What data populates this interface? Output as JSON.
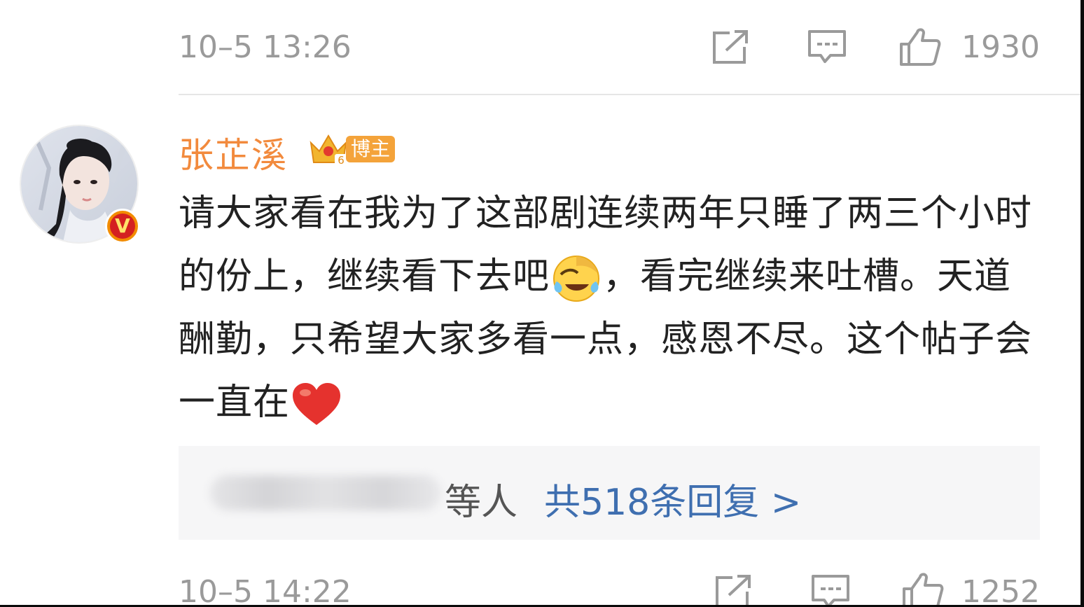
{
  "previous_comment": {
    "timestamp": "10–5 13:26",
    "like_count": "1930"
  },
  "comment": {
    "author": "张芷溪",
    "badge_label": "博主",
    "badge_level": "6",
    "verified_mark": "V",
    "text_part1": "请大家看在我为了这部剧连续两年只睡了两三个小时的份上，继续看下去吧",
    "text_part2": "，看完继续来吐槽。天道酬勤，只希望大家多看一点，感恩不尽。这个帖子会一直在",
    "emojis": [
      "laugh-cry-emoji",
      "red-heart-emoji"
    ]
  },
  "replies": {
    "prefix": "等人",
    "link": "共518条回复 >"
  },
  "comment_meta": {
    "timestamp": "10–5 14:22",
    "like_count": "1252"
  },
  "icons": {
    "share": "share-icon",
    "comment": "comment-icon",
    "like": "thumbs-up-icon"
  },
  "colors": {
    "author": "#f28a3d",
    "link": "#3f6fb0",
    "meta": "#9a9a9a",
    "badge": "#f4a33a"
  }
}
